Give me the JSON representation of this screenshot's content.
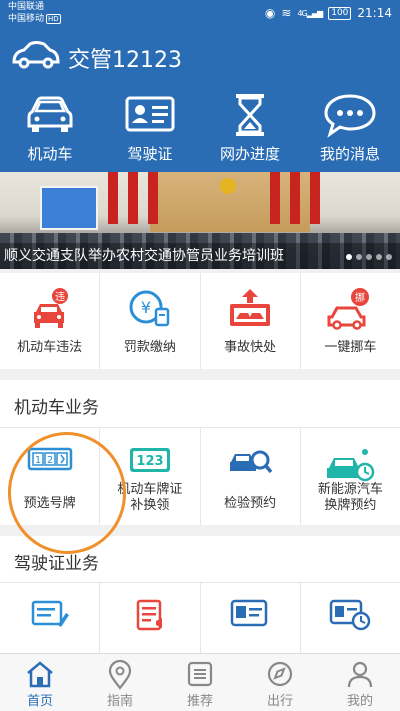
{
  "status_bar": {
    "carrier1": "中国联通",
    "carrier2": "中国移动",
    "hd_badge": "HD",
    "signal_label": "4G",
    "battery": "100",
    "time": "21:14"
  },
  "header": {
    "title": "交管12123"
  },
  "quick_nav": [
    {
      "label": "机动车",
      "icon": "car-icon"
    },
    {
      "label": "驾驶证",
      "icon": "license-card-icon"
    },
    {
      "label": "网办进度",
      "icon": "hourglass-icon"
    },
    {
      "label": "我的消息",
      "icon": "message-bubble-icon"
    }
  ],
  "banner": {
    "caption": "顺义交通支队举办农村交通协管员业务培训班",
    "slide_count": 5,
    "active_slide": 1
  },
  "services": [
    {
      "label": "机动车违法",
      "icon": "violation-car-icon"
    },
    {
      "label": "罚款缴纳",
      "icon": "fine-payment-icon"
    },
    {
      "label": "事故快处",
      "icon": "accident-icon"
    },
    {
      "label": "一键挪车",
      "icon": "move-car-icon"
    }
  ],
  "vehicle_section": {
    "title": "机动车业务",
    "items": [
      {
        "label_line1": "预选号牌",
        "label_line2": "",
        "icon": "plate-select-icon"
      },
      {
        "label_line1": "机动车牌证",
        "label_line2": "补换领",
        "icon": "plate-123-icon"
      },
      {
        "label_line1": "检验预约",
        "label_line2": "",
        "icon": "inspection-icon"
      },
      {
        "label_line1": "新能源汽车",
        "label_line2": "换牌预约",
        "icon": "new-energy-car-icon"
      }
    ]
  },
  "license_section": {
    "title": "驾驶证业务",
    "items": [
      {
        "icon": "license-edit-icon"
      },
      {
        "icon": "license-notice-icon"
      },
      {
        "icon": "license-card-icon"
      },
      {
        "icon": "license-time-icon"
      }
    ]
  },
  "tabs": [
    {
      "label": "首页",
      "icon": "home-icon",
      "active": true
    },
    {
      "label": "指南",
      "icon": "location-pin-icon",
      "active": false
    },
    {
      "label": "推荐",
      "icon": "list-icon",
      "active": false
    },
    {
      "label": "出行",
      "icon": "compass-icon",
      "active": false
    },
    {
      "label": "我的",
      "icon": "user-icon",
      "active": false
    }
  ],
  "colors": {
    "brand_blue": "#2a6db5",
    "accent_red": "#e8463c",
    "accent_teal": "#1fb5a8",
    "annotation_orange": "#f0902a"
  }
}
